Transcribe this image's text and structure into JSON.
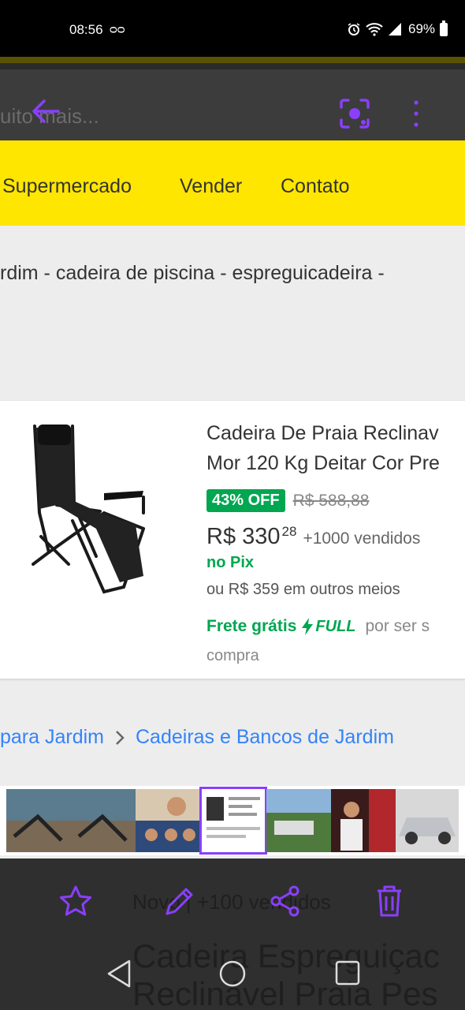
{
  "status_bar": {
    "time": "08:56",
    "voicemail": "ᴑᴑ",
    "battery": "69%"
  },
  "header": {
    "search_text": "uito mais...",
    "icons": [
      "back-arrow-icon",
      "lens-icon",
      "more-vertical-icon"
    ]
  },
  "nav": {
    "items": [
      "Supermercado",
      "Vender",
      "Contato"
    ]
  },
  "keywords": "rdim - cadeira de piscina - espreguicadeira -",
  "product": {
    "title_line1": "Cadeira De Praia Reclinav",
    "title_line2": "Mor 120 Kg Deitar Cor Pre",
    "discount": "43% OFF",
    "old_price": "R$ 588,88",
    "price": "R$ 330",
    "price_cents": "28",
    "sold": "+1000 vendidos",
    "pix": "no Pix",
    "other_methods": "ou R$ 359 em outros meios",
    "free_shipping": "Frete grátis",
    "full_label": "FULL",
    "shipping_extra": "por ser s",
    "shipping_extra2": "compra"
  },
  "categories": {
    "crumb1": "para Jardim",
    "crumb2": "Cadeiras e Bancos de Jardim"
  },
  "action_bar": {
    "ghost_line1": "Novo  |  +100 vendidos",
    "ghost_title1": "Cadeira Espreguiçac",
    "ghost_title2": "Reclinável Praia Pes",
    "icons": [
      "star-icon",
      "edit-icon",
      "share-icon",
      "trash-icon"
    ]
  },
  "colors": {
    "accent": "#8a3ffc",
    "brand_yellow": "#ffe600",
    "green": "#00a650",
    "link_blue": "#3483fa"
  }
}
